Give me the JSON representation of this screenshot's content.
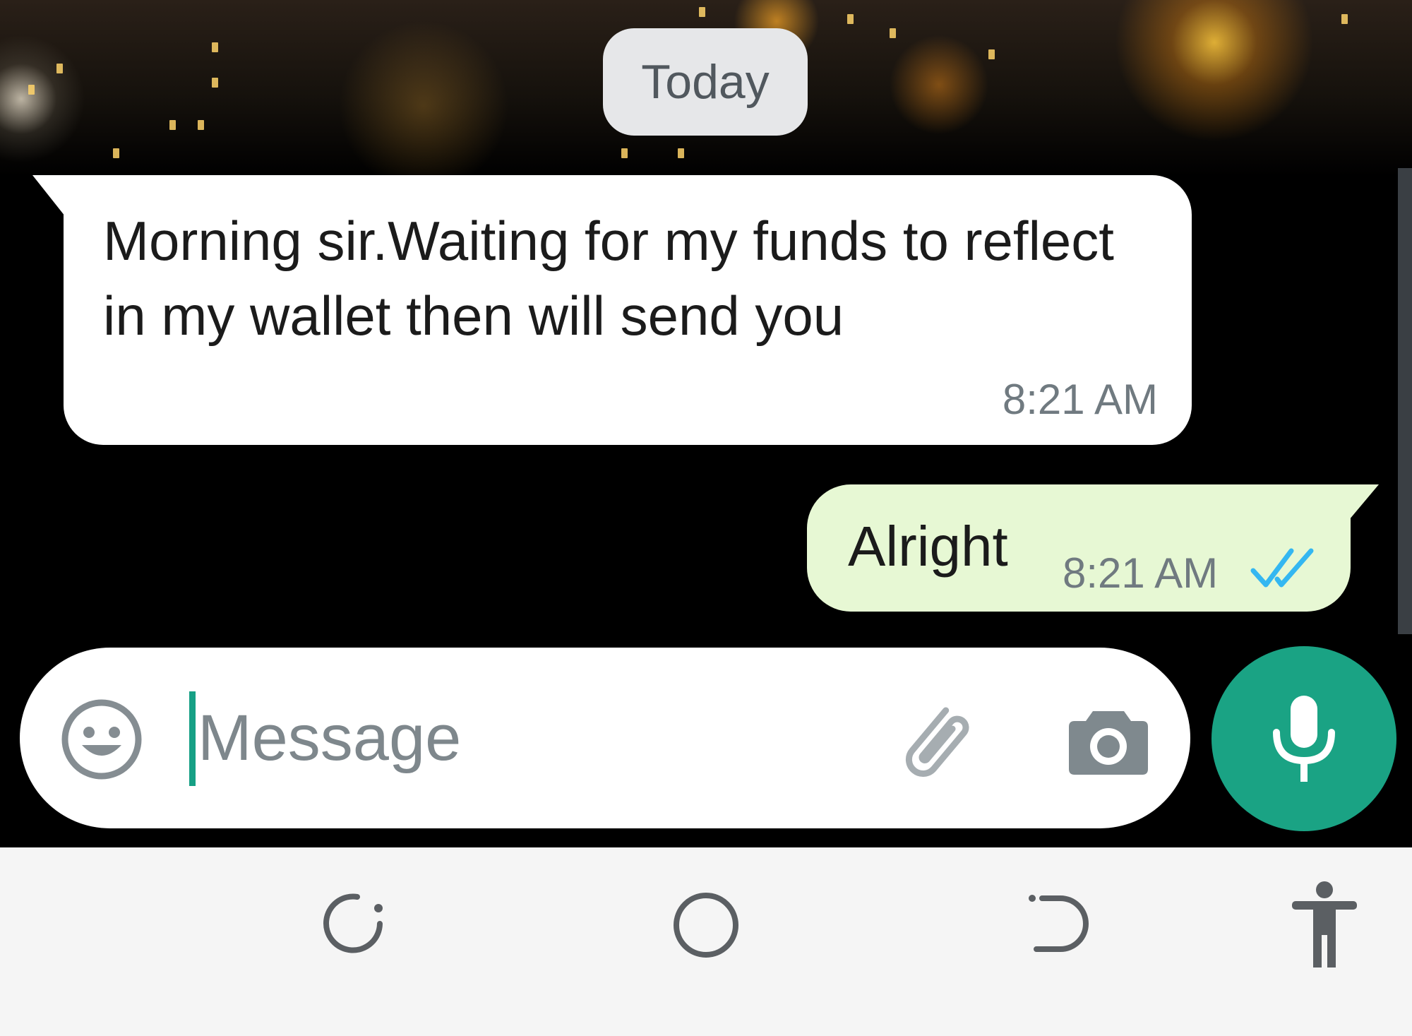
{
  "chat": {
    "date_chip": "Today",
    "messages": [
      {
        "direction": "incoming",
        "text": "Morning sir.Waiting for my funds to reflect in my wallet then will send you",
        "time": "8:21 AM"
      },
      {
        "direction": "outgoing",
        "text": "Alright",
        "time": "8:21 AM",
        "status": "read",
        "status_icon": "double-check-icon"
      }
    ]
  },
  "composer": {
    "placeholder": "Message",
    "value": "",
    "icons": {
      "emoji": "smiley-icon",
      "attach": "paperclip-icon",
      "camera": "camera-icon",
      "voice": "microphone-icon"
    }
  },
  "nav_bar": {
    "buttons": [
      "recent-apps-icon",
      "home-icon",
      "back-icon",
      "accessibility-icon"
    ]
  },
  "colors": {
    "accent": "#1aa384",
    "incoming_bubble": "#ffffff",
    "outgoing_bubble": "#e7f8d4",
    "read_ticks": "#34b7f1",
    "nav_bar": "#f5f5f5",
    "timestamp": "#707a80"
  }
}
